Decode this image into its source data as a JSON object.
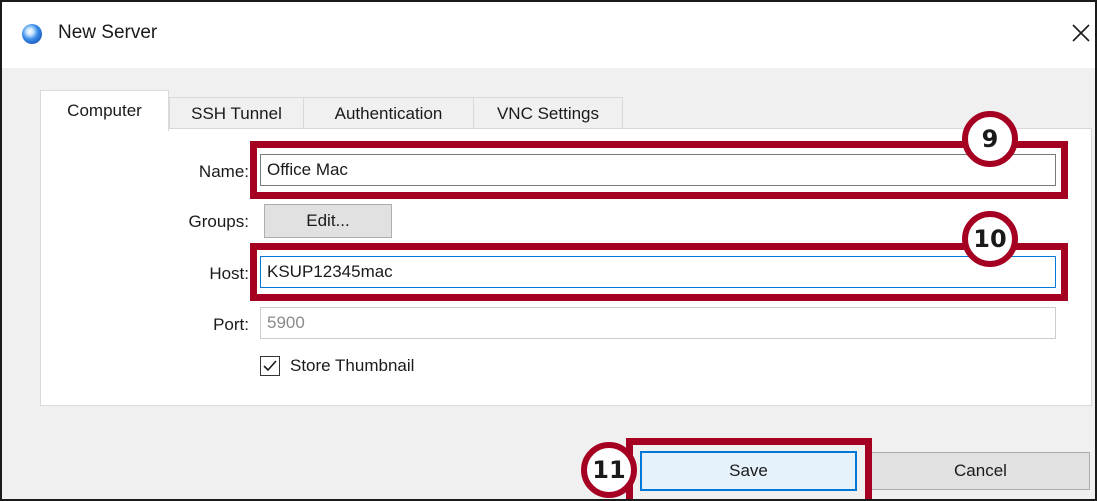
{
  "window": {
    "title": "New Server",
    "app_icon": "app-globe-icon",
    "close_icon": "close-icon"
  },
  "tabs": [
    {
      "label": "Computer",
      "active": true
    },
    {
      "label": "SSH Tunnel",
      "active": false
    },
    {
      "label": "Authentication",
      "active": false
    },
    {
      "label": "VNC Settings",
      "active": false
    }
  ],
  "form": {
    "name": {
      "label": "Name:",
      "value": "Office Mac"
    },
    "groups": {
      "label": "Groups:",
      "button_label": "Edit..."
    },
    "host": {
      "label": "Host:",
      "value": "KSUP12345mac"
    },
    "port": {
      "label": "Port:",
      "value": "5900"
    },
    "store_thumbnail": {
      "label": "Store Thumbnail",
      "checked": true
    }
  },
  "buttons": {
    "save": "Save",
    "cancel": "Cancel"
  },
  "callouts": {
    "step_9": "9",
    "step_10": "10",
    "step_11": "11"
  },
  "colors": {
    "annotation_red": "#a50021",
    "focus_blue": "#0078d7"
  }
}
